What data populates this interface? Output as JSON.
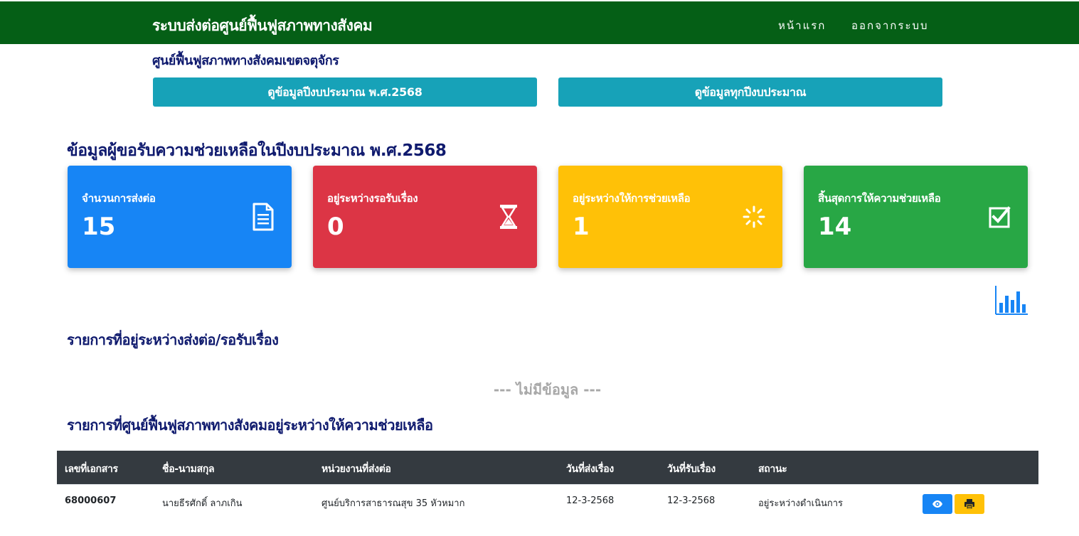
{
  "header": {
    "brand": "ระบบส่งต่อศูนย์ฟื้นฟูสภาพทางสังคม",
    "nav": {
      "home": "หน้าแรก",
      "logout": "ออกจากระบบ"
    },
    "bg_color": "#055f16"
  },
  "center_name": "ศูนย์ฟื้นฟูสภาพทางสังคมเขตจตุจักร",
  "year_buttons": {
    "current": "ดูข้อมูลปีงบประมาณ พ.ศ.2568",
    "all": "ดูข้อมูลทุกปีงบประมาณ"
  },
  "section_title": "ข้อมูลผู้ขอรับความช่วยเหลือในปีงบประมาณ พ.ศ.2568",
  "stats": [
    {
      "label": "จำนวนการส่งต่อ",
      "value": "15",
      "icon": "document-icon",
      "color": "#1785f5"
    },
    {
      "label": "อยู่ระหว่างรอรับเรื่อง",
      "value": "0",
      "icon": "hourglass-icon",
      "color": "#dc3545"
    },
    {
      "label": "อยู่ระหว่างให้การช่วยเหลือ",
      "value": "1",
      "icon": "spinner-icon",
      "color": "#ffc107"
    },
    {
      "label": "สิ้นสุดการให้ความช่วยเหลือ",
      "value": "14",
      "icon": "check-square-icon",
      "color": "#28a745"
    }
  ],
  "chart_icon": "bar-chart-icon",
  "pending_section": {
    "title": "รายการที่อยู่ระหว่างส่งต่อ/รอรับเรื่อง",
    "empty_text": "--- ไม่มีข้อมูล ---"
  },
  "in_progress_section": {
    "title": "รายการที่ศูนย์ฟื้นฟูสภาพทางสังคมอยู่ระหว่างให้ความช่วยเหลือ",
    "columns": [
      "เลขที่เอกสาร",
      "ชื่อ-นามสกุล",
      "หน่วยงานที่ส่งต่อ",
      "วันที่ส่งเรื่อง",
      "วันที่รับเรื่อง",
      "สถานะ"
    ],
    "rows": [
      {
        "doc_no": "68000607",
        "name": "นายธีรศักดิ์ ลาภเกิน",
        "agency": "ศูนย์บริการสาธารณสุข 35 หัวหมาก",
        "sent_date": "12-3-2568",
        "received_date": "12-3-2568",
        "status": "อยู่ระหว่างดำเนินการ"
      }
    ]
  }
}
